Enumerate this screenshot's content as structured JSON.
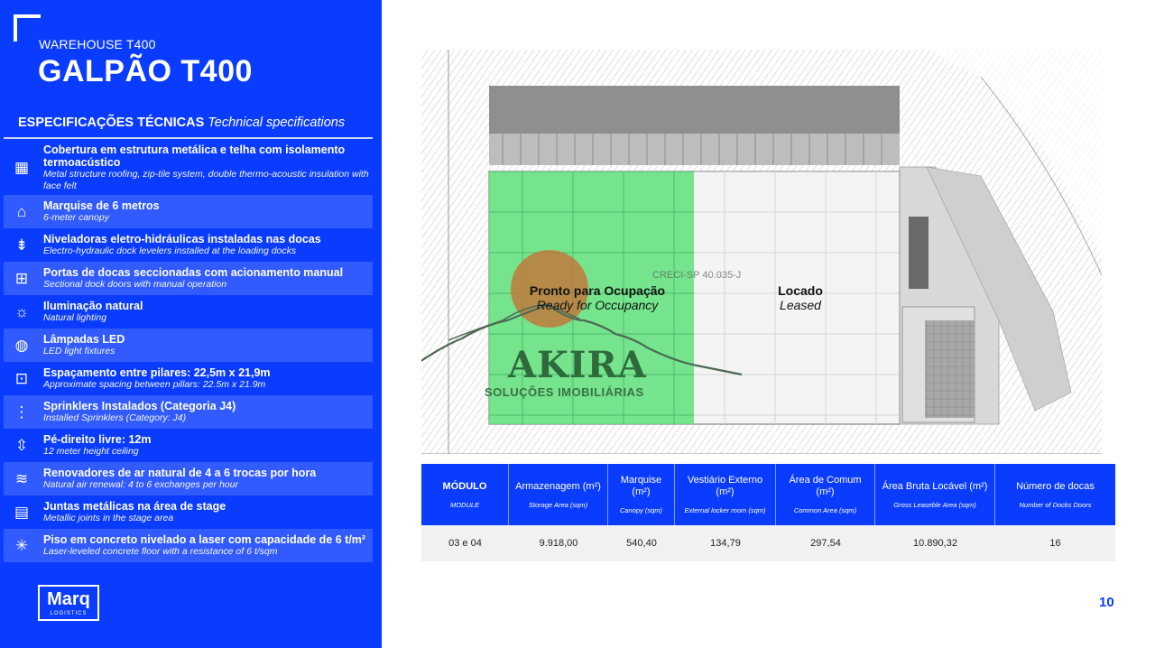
{
  "header": {
    "subtitle": "WAREHOUSE T400",
    "title": "GALPÃO T400"
  },
  "specs": {
    "heading_pt": "ESPECIFICAÇÕES TÉCNICAS",
    "heading_en": "Technical specifications",
    "items": [
      {
        "icon": "roof-icon",
        "pt": "Cobertura em estrutura metálica e telha com isolamento termoacústico",
        "en": "Metal structure roofing, zip-tile system, double thermo-acoustic insulation with face felt"
      },
      {
        "icon": "canopy-icon",
        "pt": "Marquise de 6 metros",
        "en": "6-meter canopy"
      },
      {
        "icon": "dock-leveler-icon",
        "pt": "Niveladoras eletro-hidráulicas instaladas nas docas",
        "en": "Electro-hydraulic dock levelers installed at the loading docks"
      },
      {
        "icon": "dock-door-icon",
        "pt": "Portas de docas seccionadas com acionamento manual",
        "en": "Sectional dock doors with manual operation"
      },
      {
        "icon": "natural-light-icon",
        "pt": "Iluminação natural",
        "en": "Natural lighting"
      },
      {
        "icon": "led-icon",
        "pt": "Lâmpadas LED",
        "en": "LED light fixtures"
      },
      {
        "icon": "pillar-spacing-icon",
        "pt": "Espaçamento entre pilares: 22,5m x 21,9m",
        "en": "Approximate spacing between pillars: 22.5m x 21.9m"
      },
      {
        "icon": "sprinkler-icon",
        "pt": "Sprinklers Instalados (Categoria J4)",
        "en": "Installed Sprinklers (Category: J4)"
      },
      {
        "icon": "ceiling-height-icon",
        "pt": "Pé-direito livre: 12m",
        "en": "12 meter height ceiling"
      },
      {
        "icon": "air-renewal-icon",
        "pt": "Renovadores de ar natural de 4 a 6 trocas por hora",
        "en": "Natural air renewal: 4 to 6 exchanges per hour"
      },
      {
        "icon": "metal-joint-icon",
        "pt": "Juntas metálicas na área de stage",
        "en": "Metallic joints in the stage area"
      },
      {
        "icon": "laser-floor-icon",
        "pt": "Piso em concreto nivelado a laser com capacidade de 6 t/m²",
        "en": "Laser-leveled concrete floor with a resistance of 6 t/sqm"
      }
    ]
  },
  "logo": {
    "main": "Marq",
    "sub": "LOGISTICS"
  },
  "plan": {
    "available_pt": "Pronto para Ocupação",
    "available_en": "Ready for Occupancy",
    "leased_pt": "Locado",
    "leased_en": "Leased",
    "watermark_creci": "CRECI-SP 40.035-J",
    "watermark_brand": "AKIRA",
    "watermark_brand_sub": "SOLUÇÕES IMOBILIÁRIAS",
    "available_color": "#5ee07a",
    "leased_color": "#f2f2f2"
  },
  "table": {
    "headers": [
      {
        "pt": "MÓDULO",
        "en": "MODULE"
      },
      {
        "pt": "Armazenagem (m²)",
        "en": "Storage Area (sqm)"
      },
      {
        "pt": "Marquise (m²)",
        "en": "Canopy (sqm)"
      },
      {
        "pt": "Vestiário Externo (m²)",
        "en": "External locker room (sqm)"
      },
      {
        "pt": "Área de Comum (m²)",
        "en": "Common Area (sqm)"
      },
      {
        "pt": "Área Bruta Locável (m²)",
        "en": "Gross Leaseble Area (sqm)"
      },
      {
        "pt": "Número de docas",
        "en": "Number of Docks Doors"
      }
    ],
    "rows": [
      [
        "03 e 04",
        "9.918,00",
        "540,40",
        "134,79",
        "297,54",
        "10.890,32",
        "16"
      ]
    ]
  },
  "page_number": "10"
}
